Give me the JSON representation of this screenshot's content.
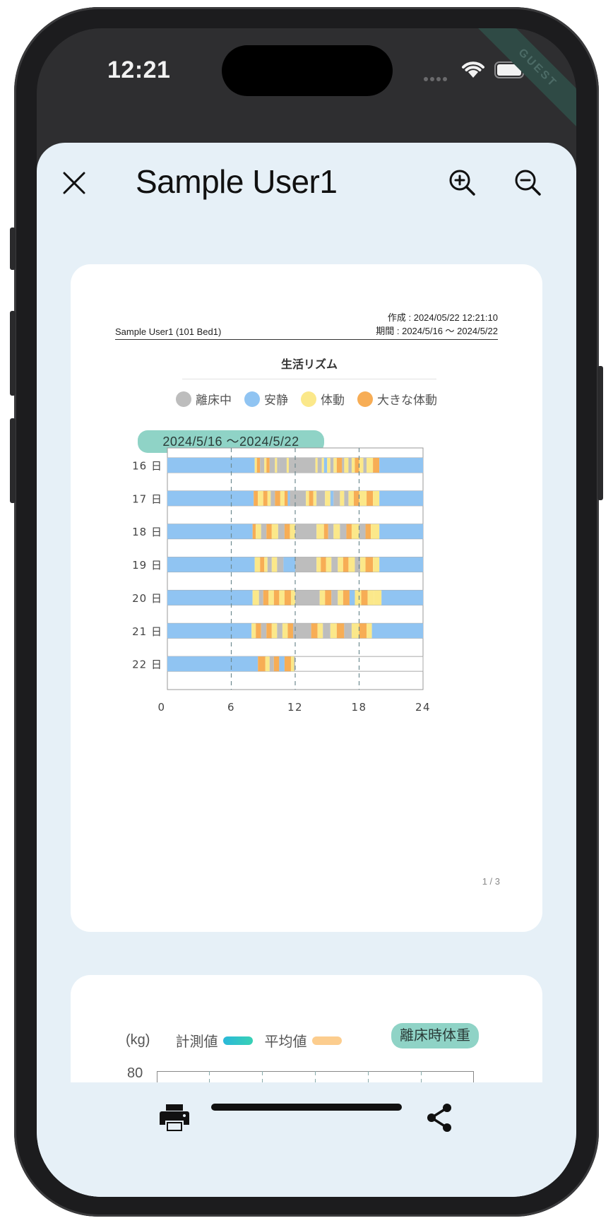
{
  "status_bar": {
    "time": "12:21",
    "ribbon": "GUEST"
  },
  "header": {
    "title": "Sample User1"
  },
  "report": {
    "user_line": "Sample User1 (101 Bed1)",
    "created_line": "作成 : 2024/05/22 12:21:10",
    "period_line": "期間 : 2024/5/16 〜 2024/5/22",
    "chart_title": "生活リズム",
    "legend": [
      {
        "label": "離床中",
        "color": "#bdbdbd"
      },
      {
        "label": "安静",
        "color": "#90c4f2"
      },
      {
        "label": "体動",
        "color": "#fbe88a"
      },
      {
        "label": "大きな体動",
        "color": "#f7ad55"
      }
    ],
    "date_range_badge": "2024/5/16 〜2024/5/22",
    "page_number": "1 / 3"
  },
  "chart_data": {
    "type": "heatmap",
    "title": "生活リズム",
    "x_ticks": [
      "0",
      "6",
      "12",
      "18",
      "24"
    ],
    "xlim": [
      0,
      24
    ],
    "rows": [
      {
        "label": "16 日",
        "segments": [
          [
            0,
            8.2,
            "rest"
          ],
          [
            8.2,
            8.4,
            "motion"
          ],
          [
            8.4,
            8.7,
            "big"
          ],
          [
            8.7,
            9.1,
            "absent"
          ],
          [
            9.1,
            9.3,
            "motion"
          ],
          [
            9.3,
            9.6,
            "big"
          ],
          [
            9.6,
            10.1,
            "absent"
          ],
          [
            10.1,
            10.3,
            "motion"
          ],
          [
            10.3,
            10.5,
            "absent"
          ],
          [
            10.5,
            11.2,
            "absent"
          ],
          [
            11.2,
            11.4,
            "motion"
          ],
          [
            11.4,
            13.9,
            "absent"
          ],
          [
            13.9,
            14.1,
            "motion"
          ],
          [
            14.1,
            14.5,
            "absent"
          ],
          [
            14.5,
            14.7,
            "motion"
          ],
          [
            14.7,
            15.0,
            "rest"
          ],
          [
            15.0,
            15.3,
            "motion"
          ],
          [
            15.3,
            15.6,
            "absent"
          ],
          [
            15.6,
            15.9,
            "motion"
          ],
          [
            15.9,
            16.4,
            "big"
          ],
          [
            16.4,
            16.6,
            "absent"
          ],
          [
            16.6,
            17.0,
            "motion"
          ],
          [
            17.0,
            17.3,
            "absent"
          ],
          [
            17.3,
            17.6,
            "motion"
          ],
          [
            17.6,
            18.0,
            "big"
          ],
          [
            18.0,
            18.4,
            "motion"
          ],
          [
            18.4,
            18.7,
            "absent"
          ],
          [
            18.7,
            19.3,
            "motion"
          ],
          [
            19.3,
            19.9,
            "big"
          ],
          [
            19.9,
            24,
            "rest"
          ]
        ]
      },
      {
        "label": "17 日",
        "segments": [
          [
            0,
            8.1,
            "rest"
          ],
          [
            8.1,
            8.5,
            "big"
          ],
          [
            8.5,
            9.0,
            "motion"
          ],
          [
            9.0,
            9.4,
            "big"
          ],
          [
            9.4,
            9.7,
            "motion"
          ],
          [
            9.7,
            10.1,
            "absent"
          ],
          [
            10.1,
            10.6,
            "big"
          ],
          [
            10.6,
            11.0,
            "motion"
          ],
          [
            11.0,
            11.3,
            "big"
          ],
          [
            11.3,
            11.5,
            "rest"
          ],
          [
            11.5,
            13.0,
            "absent"
          ],
          [
            13.0,
            13.3,
            "motion"
          ],
          [
            13.3,
            13.7,
            "big"
          ],
          [
            13.7,
            14.0,
            "motion"
          ],
          [
            14.0,
            14.8,
            "absent"
          ],
          [
            14.8,
            15.3,
            "motion"
          ],
          [
            15.3,
            15.6,
            "rest"
          ],
          [
            15.6,
            16.2,
            "absent"
          ],
          [
            16.2,
            16.6,
            "motion"
          ],
          [
            16.6,
            17.0,
            "absent"
          ],
          [
            17.0,
            17.5,
            "motion"
          ],
          [
            17.5,
            18.0,
            "big"
          ],
          [
            18.0,
            18.7,
            "motion"
          ],
          [
            18.7,
            19.3,
            "big"
          ],
          [
            19.3,
            19.9,
            "motion"
          ],
          [
            19.9,
            24,
            "rest"
          ]
        ]
      },
      {
        "label": "18 日",
        "segments": [
          [
            0,
            8.0,
            "rest"
          ],
          [
            8.0,
            8.3,
            "big"
          ],
          [
            8.3,
            8.8,
            "motion"
          ],
          [
            8.8,
            9.3,
            "absent"
          ],
          [
            9.3,
            9.8,
            "big"
          ],
          [
            9.8,
            10.4,
            "motion"
          ],
          [
            10.4,
            11.0,
            "absent"
          ],
          [
            11.0,
            11.5,
            "big"
          ],
          [
            11.5,
            12.0,
            "motion"
          ],
          [
            12.0,
            14.0,
            "absent"
          ],
          [
            14.0,
            14.7,
            "motion"
          ],
          [
            14.7,
            15.1,
            "big"
          ],
          [
            15.1,
            15.6,
            "absent"
          ],
          [
            15.6,
            16.2,
            "motion"
          ],
          [
            16.2,
            16.8,
            "absent"
          ],
          [
            16.8,
            17.3,
            "big"
          ],
          [
            17.3,
            18.0,
            "motion"
          ],
          [
            18.0,
            18.6,
            "absent"
          ],
          [
            18.6,
            19.1,
            "big"
          ],
          [
            19.1,
            19.9,
            "motion"
          ],
          [
            19.9,
            24,
            "rest"
          ]
        ]
      },
      {
        "label": "19 日",
        "segments": [
          [
            0,
            8.2,
            "rest"
          ],
          [
            8.2,
            8.7,
            "motion"
          ],
          [
            8.7,
            9.1,
            "big"
          ],
          [
            9.1,
            9.4,
            "motion"
          ],
          [
            9.4,
            9.8,
            "absent"
          ],
          [
            9.8,
            10.3,
            "motion"
          ],
          [
            10.3,
            10.9,
            "absent"
          ],
          [
            10.9,
            12.0,
            "rest"
          ],
          [
            12.0,
            14.0,
            "absent"
          ],
          [
            14.0,
            14.4,
            "motion"
          ],
          [
            14.4,
            14.9,
            "big"
          ],
          [
            14.9,
            15.4,
            "motion"
          ],
          [
            15.4,
            16.0,
            "absent"
          ],
          [
            16.0,
            16.5,
            "motion"
          ],
          [
            16.5,
            17.0,
            "big"
          ],
          [
            17.0,
            17.6,
            "motion"
          ],
          [
            17.6,
            18.1,
            "absent"
          ],
          [
            18.1,
            18.6,
            "motion"
          ],
          [
            18.6,
            19.3,
            "big"
          ],
          [
            19.3,
            19.9,
            "motion"
          ],
          [
            19.9,
            24,
            "rest"
          ]
        ]
      },
      {
        "label": "20 日",
        "segments": [
          [
            0,
            8.0,
            "rest"
          ],
          [
            8.0,
            8.6,
            "motion"
          ],
          [
            8.6,
            9.0,
            "absent"
          ],
          [
            9.0,
            9.5,
            "big"
          ],
          [
            9.5,
            10.0,
            "motion"
          ],
          [
            10.0,
            10.5,
            "big"
          ],
          [
            10.5,
            11.0,
            "motion"
          ],
          [
            11.0,
            11.6,
            "big"
          ],
          [
            11.6,
            12.0,
            "motion"
          ],
          [
            12.0,
            14.3,
            "absent"
          ],
          [
            14.3,
            14.8,
            "motion"
          ],
          [
            14.8,
            15.4,
            "big"
          ],
          [
            15.4,
            16.0,
            "absent"
          ],
          [
            16.0,
            16.5,
            "motion"
          ],
          [
            16.5,
            17.1,
            "big"
          ],
          [
            17.1,
            17.6,
            "rest"
          ],
          [
            17.6,
            18.2,
            "motion"
          ],
          [
            18.2,
            18.8,
            "big"
          ],
          [
            18.8,
            19.4,
            "motion"
          ],
          [
            19.4,
            20.1,
            "motion"
          ],
          [
            20.1,
            24,
            "rest"
          ]
        ]
      },
      {
        "label": "21 日",
        "segments": [
          [
            0,
            7.9,
            "rest"
          ],
          [
            7.9,
            8.3,
            "motion"
          ],
          [
            8.3,
            8.8,
            "big"
          ],
          [
            8.8,
            9.3,
            "absent"
          ],
          [
            9.3,
            9.8,
            "big"
          ],
          [
            9.8,
            10.3,
            "motion"
          ],
          [
            10.3,
            10.8,
            "absent"
          ],
          [
            10.8,
            11.3,
            "motion"
          ],
          [
            11.3,
            11.8,
            "big"
          ],
          [
            11.8,
            13.5,
            "absent"
          ],
          [
            13.5,
            14.1,
            "big"
          ],
          [
            14.1,
            14.6,
            "motion"
          ],
          [
            14.6,
            15.3,
            "absent"
          ],
          [
            15.3,
            15.9,
            "motion"
          ],
          [
            15.9,
            16.6,
            "big"
          ],
          [
            16.6,
            17.3,
            "absent"
          ],
          [
            17.3,
            18.0,
            "motion"
          ],
          [
            18.0,
            18.7,
            "big"
          ],
          [
            18.7,
            19.2,
            "motion"
          ],
          [
            19.2,
            24,
            "rest"
          ]
        ]
      },
      {
        "label": "22 日",
        "segments": [
          [
            0,
            8.5,
            "rest"
          ],
          [
            8.5,
            9.2,
            "big"
          ],
          [
            9.2,
            9.6,
            "motion"
          ],
          [
            9.6,
            10.0,
            "absent"
          ],
          [
            10.0,
            10.5,
            "big"
          ],
          [
            10.5,
            11.0,
            "rest"
          ],
          [
            11.0,
            11.6,
            "big"
          ],
          [
            11.6,
            11.9,
            "motion"
          ],
          [
            11.9,
            12.0,
            "absent"
          ]
        ]
      }
    ]
  },
  "weight_page": {
    "unit": "(kg)",
    "measured_label": "計測値",
    "average_label": "平均値",
    "badge": "離床時体重",
    "y_top": "80"
  }
}
